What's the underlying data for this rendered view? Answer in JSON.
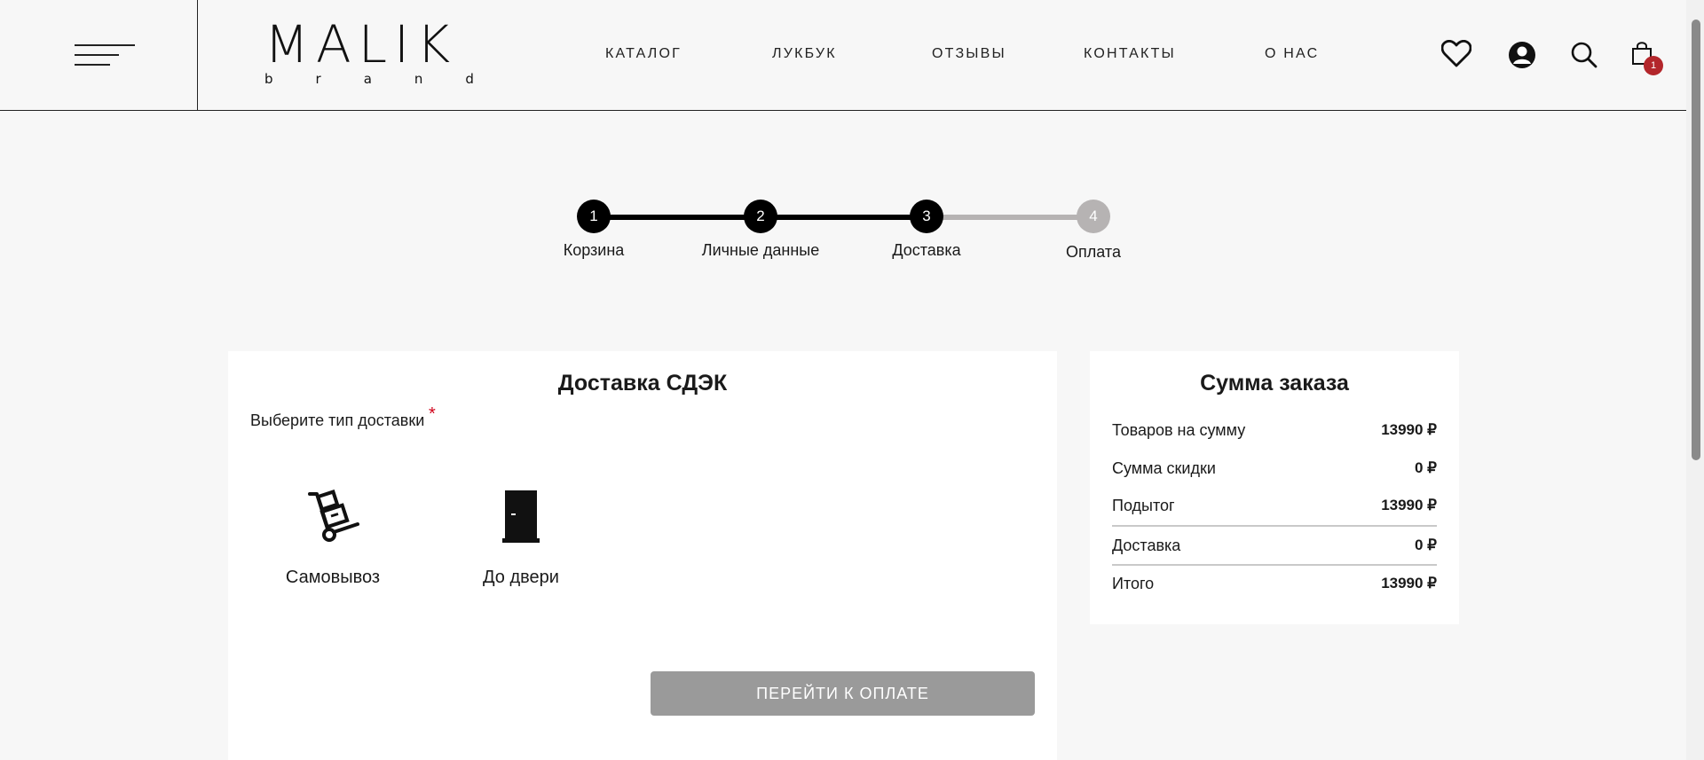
{
  "header": {
    "logo_main": "MALIK",
    "logo_sub": [
      "b",
      "r",
      "a",
      "n",
      "d"
    ],
    "nav": [
      {
        "label": "КАТАЛОГ"
      },
      {
        "label": "ЛУКБУК"
      },
      {
        "label": "ОТЗЫВЫ"
      },
      {
        "label": "КОНТАКТЫ"
      },
      {
        "label": "О НАС"
      }
    ],
    "icons": [
      "heart-icon",
      "user-icon",
      "search-icon",
      "bag-icon"
    ],
    "cart_count": "1"
  },
  "steps": [
    {
      "number": "1",
      "label": "Корзина",
      "state": "done"
    },
    {
      "number": "2",
      "label": "Личные данные",
      "state": "done"
    },
    {
      "number": "3",
      "label": "Доставка",
      "state": "current"
    },
    {
      "number": "4",
      "label": "Оплата",
      "state": "pending"
    }
  ],
  "delivery": {
    "title": "Доставка СДЭК",
    "subtitle": "Выберите тип доставки",
    "required_mark": "*",
    "options": [
      {
        "label": "Самовывоз",
        "icon": "hand-truck-icon"
      },
      {
        "label": "До двери",
        "icon": "door-icon"
      }
    ],
    "button_label": "ПЕРЕЙТИ К ОПЛАТЕ"
  },
  "summary": {
    "title": "Сумма заказа",
    "rows": [
      {
        "label": "Товаров на сумму",
        "value": "13990 ₽"
      },
      {
        "label": "Сумма скидки",
        "value": "0 ₽"
      },
      {
        "label": "Подытог",
        "value": "13990 ₽"
      },
      {
        "label": "Доставка",
        "value": "0 ₽"
      },
      {
        "label": "Итого",
        "value": "13990 ₽"
      }
    ]
  },
  "colors": {
    "background": "#f7f7f7",
    "active_step": "#000000",
    "pending_step": "#b6b3b3",
    "badge": "#b3262b",
    "button": "#9a9a9a",
    "required": "#d0021b"
  }
}
